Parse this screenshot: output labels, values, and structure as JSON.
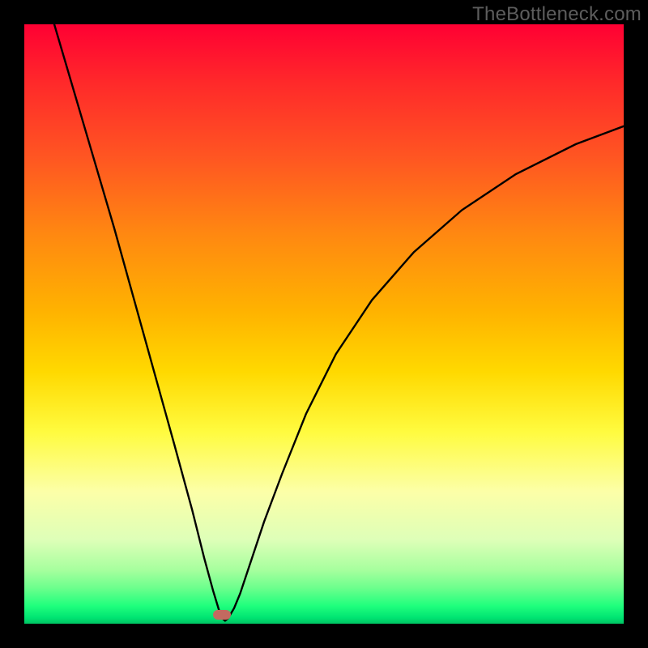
{
  "watermark": "TheBottleneck.com",
  "chart_data": {
    "type": "line",
    "title": "",
    "xlabel": "",
    "ylabel": "",
    "xlim": [
      0,
      100
    ],
    "ylim": [
      0,
      100
    ],
    "series": [
      {
        "name": "curve",
        "x": [
          5,
          10,
          15,
          20,
          25,
          28,
          30,
          31.5,
          32.5,
          33,
          33.5,
          34,
          35,
          36,
          38,
          40,
          43,
          47,
          52,
          58,
          65,
          73,
          82,
          92,
          100
        ],
        "y": [
          100,
          83,
          66,
          48,
          30,
          19,
          11,
          5.5,
          2.2,
          0.9,
          0.5,
          0.9,
          2.6,
          5.0,
          11,
          17,
          25,
          35,
          45,
          54,
          62,
          69,
          75,
          80,
          83
        ]
      }
    ],
    "marker": {
      "x": 33,
      "y": 1.5,
      "color": "#c36a60"
    },
    "background_gradient": {
      "top": "#ff0033",
      "mid": "#ffe13a",
      "bottom": "#00c463"
    }
  }
}
